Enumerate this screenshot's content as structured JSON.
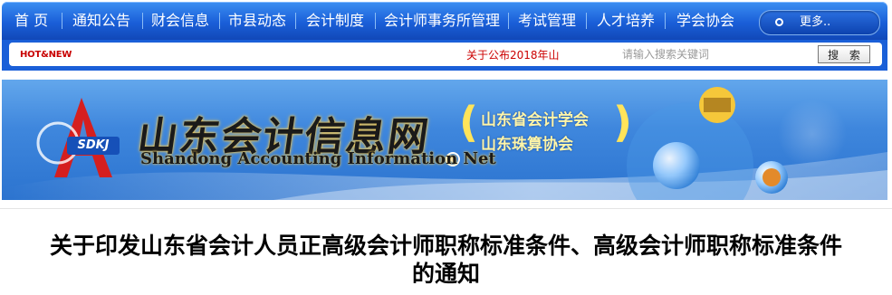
{
  "nav": {
    "items": [
      "首 页",
      "通知公告",
      "财会信息",
      "市县动态",
      "会计制度",
      "会计师事务所管理",
      "考试管理",
      "人才培养",
      "学会协会"
    ],
    "more_label": "更多.."
  },
  "strip": {
    "hot_label": "HOT&NEW",
    "ticker_text": "关于公布2018年山",
    "search_placeholder": "请输入搜索关键词",
    "search_button": "搜 索"
  },
  "banner": {
    "logo_badge": "SDKJ",
    "title_cn": "山东会计信息网",
    "title_en": "Shandong Accounting Information Net",
    "assoc_line1": "山东省会计学会",
    "assoc_line2": "山东珠算协会"
  },
  "article": {
    "title_line1": "关于印发山东省会计人员正高级会计师职称标准条件、高级会计师职称标准条件",
    "title_line2": "的通知"
  },
  "colors": {
    "nav_blue": "#1a5fd8",
    "ticker_red": "#cc0000",
    "title_gold": "#f6c84c"
  }
}
